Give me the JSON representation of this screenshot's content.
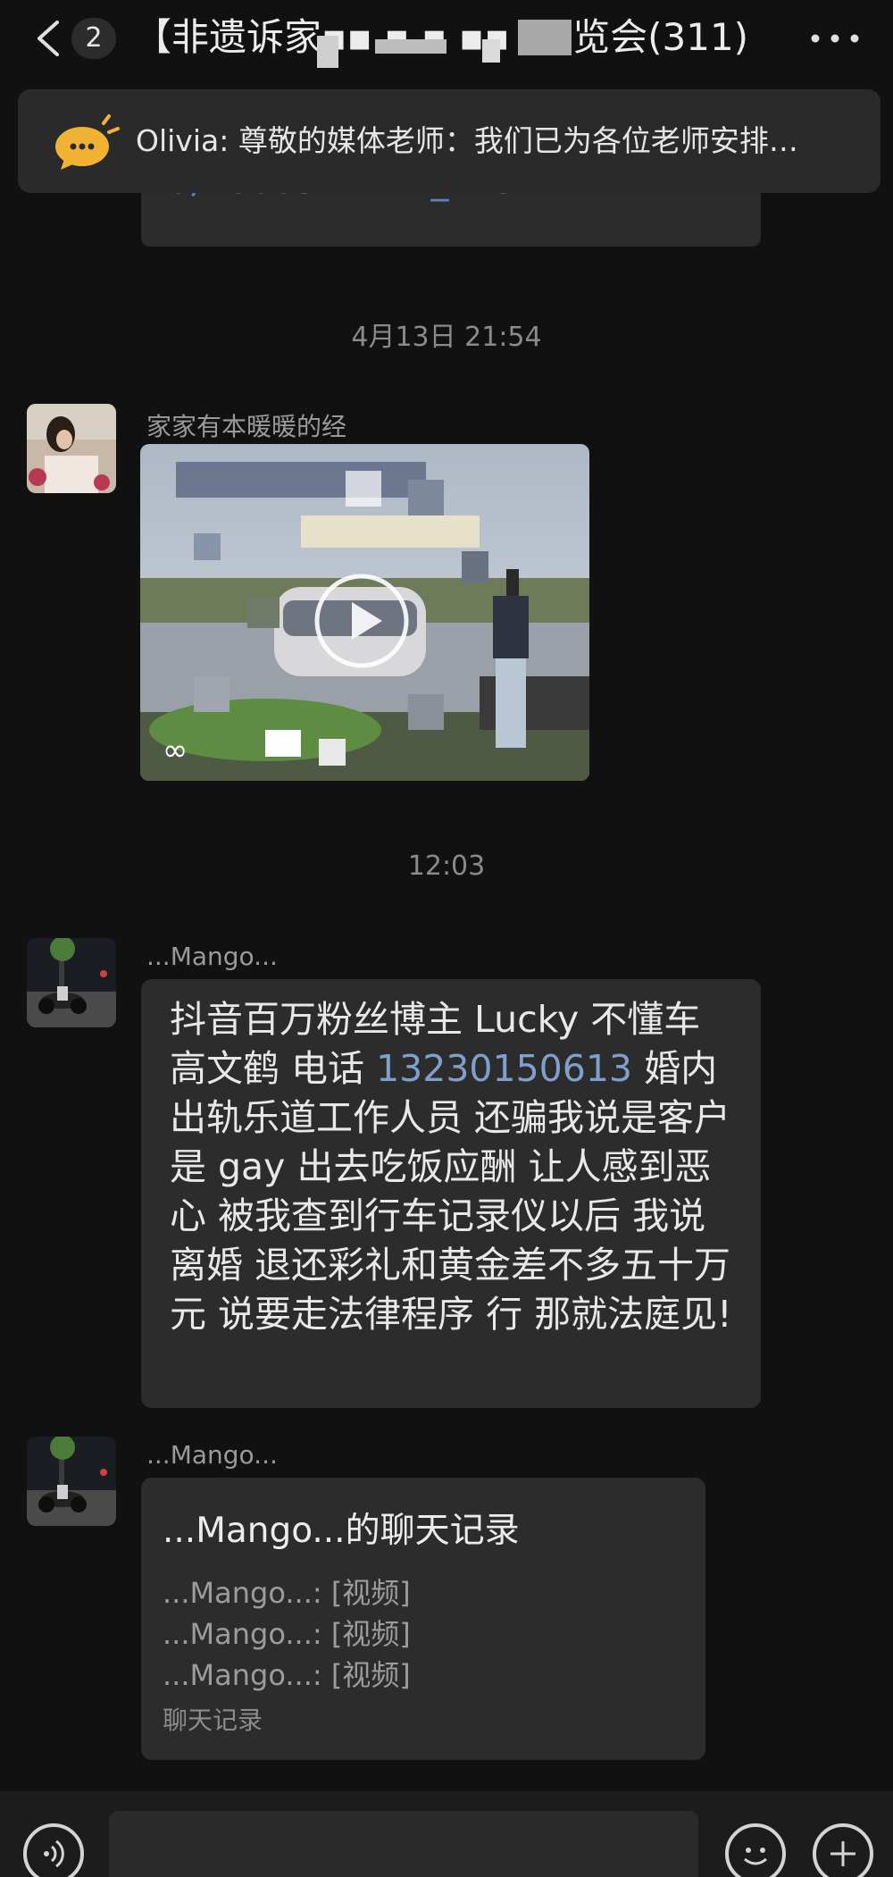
{
  "header": {
    "unread_count": "2",
    "title": "【非遗诉家▪▪ ▪ ▪ ▪▪ ▪▪览会(311)"
  },
  "announcement": {
    "text": "Olivia: 尊敬的媒体老师：我们已为各位老师安排…"
  },
  "previous_message": {
    "text": "a/1666571441_119212"
  },
  "messages": [
    {
      "type": "timestamp",
      "text": "4月13日 21:54"
    },
    {
      "type": "video",
      "sender": "家家有本暖暖的经",
      "app_mark": "∞"
    },
    {
      "type": "timestamp",
      "text": "12:03"
    },
    {
      "type": "text",
      "sender": "...Mango...",
      "text_before": "抖音百万粉丝博主 Lucky 不懂车 高文鹤 电话 ",
      "phone": "13230150613",
      "text_after": " 婚内出轨乐道工作人员 还骗我说是客户是 gay 出去吃饭应酬 让人感到恶心 被我查到行车记录仪以后 我说离婚 退还彩礼和黄金差不多五十万元 说要走法律程序 行 那就法庭见!"
    },
    {
      "type": "chat_record",
      "sender": "...Mango...",
      "title": "...Mango...的聊天记录",
      "lines": [
        "...Mango...: [视频]",
        "...Mango...: [视频]",
        "...Mango...: [视频]"
      ],
      "footer": "聊天记录"
    }
  ],
  "colors": {
    "background": "#111111",
    "bubble": "#2c2c2c",
    "link": "#7fa0cc",
    "announce_icon": "#f2b233"
  }
}
